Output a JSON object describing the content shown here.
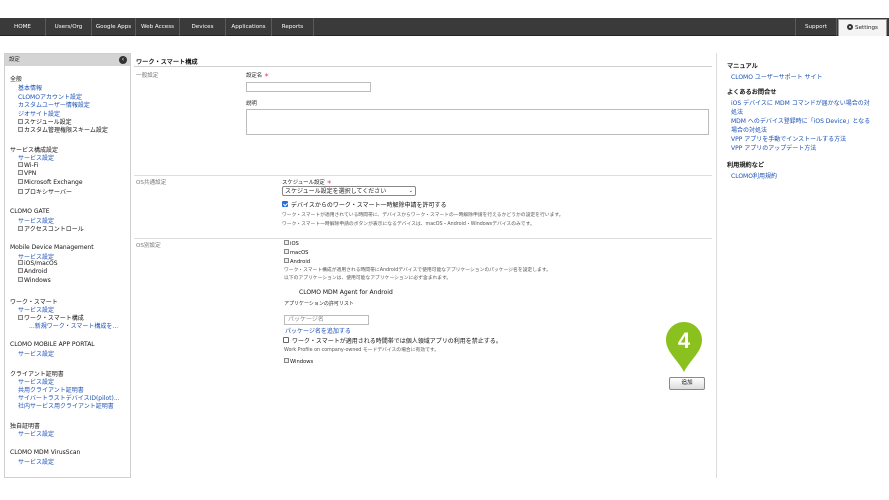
{
  "nav": {
    "items": [
      "HOME",
      "Users/Org",
      "Google Apps",
      "Web Access",
      "Devices",
      "Applications",
      "Reports"
    ],
    "support": "Support",
    "settings": "Settings"
  },
  "sidebar": {
    "header": "設定",
    "collapse_glyph": "‹",
    "general": {
      "title": "全般",
      "links": [
        "基本情報",
        "CLOMOアカウント設定",
        "カスタムユーザー情報設定",
        "ジオサイト設定"
      ],
      "tree": [
        "スケジュール設定",
        "カスタム管理権限スキーム設定"
      ]
    },
    "service": {
      "title": "サービス構成設定",
      "link": "サービス設定",
      "tree": [
        "Wi-Fi",
        "VPN",
        "Microsoft Exchange",
        "プロキシサーバー"
      ]
    },
    "gate": {
      "title": "CLOMO GATE",
      "link": "サービス設定",
      "tree": [
        "アクセスコントロール"
      ]
    },
    "mdm": {
      "title": "Mobile Device Management",
      "link": "サービス設定",
      "tree": [
        "iOS/macOS",
        "Android",
        "Windows"
      ]
    },
    "worksmart": {
      "title": "ワーク・スマート",
      "link": "サービス設定",
      "tree": [
        "ワーク・スマート構成"
      ],
      "sub": "...新規ワーク・スマート構成を..."
    },
    "portal": {
      "title": "CLOMO MOBILE APP PORTAL",
      "link": "サービス設定"
    },
    "client_cert": {
      "title": "クライアント証明書",
      "links": [
        "サービス設定",
        "共用クライアント証明書",
        "サイバートラストデバイスID(pilot)...",
        "社内サービス用クライアント証明書"
      ]
    },
    "own_cert": {
      "title": "独自証明書",
      "link": "サービス設定"
    },
    "virus": {
      "title": "CLOMO MDM VirusScan",
      "link": "サービス設定"
    }
  },
  "main": {
    "title": "ワーク・スマート構成",
    "general_label": "一般設定",
    "name_label": "設定名",
    "required_mark": "＊",
    "desc_label": "説明",
    "os_common_label": "OS共通設定",
    "schedule_label": "スケジュール設定",
    "schedule_select": "スケジュール設定を選択してください",
    "allow_temp_label": "デバイスからのワーク・スマート一時解除申請を許可する",
    "allow_temp_note1": "ワーク・スマートが適用されている時間帯に、デバイスからワーク・スマートの一時解除申請を行えるかどうかの設定を行います。",
    "allow_temp_note2": "ワーク・スマート一時解除申請のボタンが表示になるデバイスは、macOS・Android・Windowsデバイスのみです。",
    "os_specific_label": "OS別設定",
    "os_tree": [
      "iOS",
      "macOS",
      "Android"
    ],
    "android_note1": "ワーク・スマート構成が適用される時間帯にAndroidデバイスで使用可能なアプリケーションのパッケージ名を設定します。",
    "android_note2": "以下のアプリケーションは、使用可能なアプリケーションに必ず含まれます。",
    "agent": "CLOMO MDM Agent for Android",
    "allow_list_label": "アプリケーションの許可リスト",
    "package_placeholder": "パッケージ名",
    "add_package": "パッケージ名を追加する",
    "prohibit_label": "ワーク・スマートが適用される時間帯では個人領域アプリの利用を禁止する。",
    "prohibit_note": "Work Profile on company-owned モードデバイスの場合に有効です。",
    "windows": "Windows",
    "add_button": "追加"
  },
  "marker": {
    "number": "4",
    "color": "#8ac11f"
  },
  "right": {
    "manual_title": "マニュアル",
    "manual_link": "CLOMO ユーザーサポート サイト",
    "faq_title": "よくあるお問合せ",
    "faq_links": [
      "iOS デバイスに MDM コマンドが届かない場合の対",
      "処法",
      "MDM へのデバイス登録時に「iOS Device」となる",
      "場合の対処法",
      "VPP アプリを手動でインストールする方法",
      "VPP アプリのアップデート方法"
    ],
    "terms_title": "利用規約など",
    "terms_link": "CLOMO利用規約"
  }
}
